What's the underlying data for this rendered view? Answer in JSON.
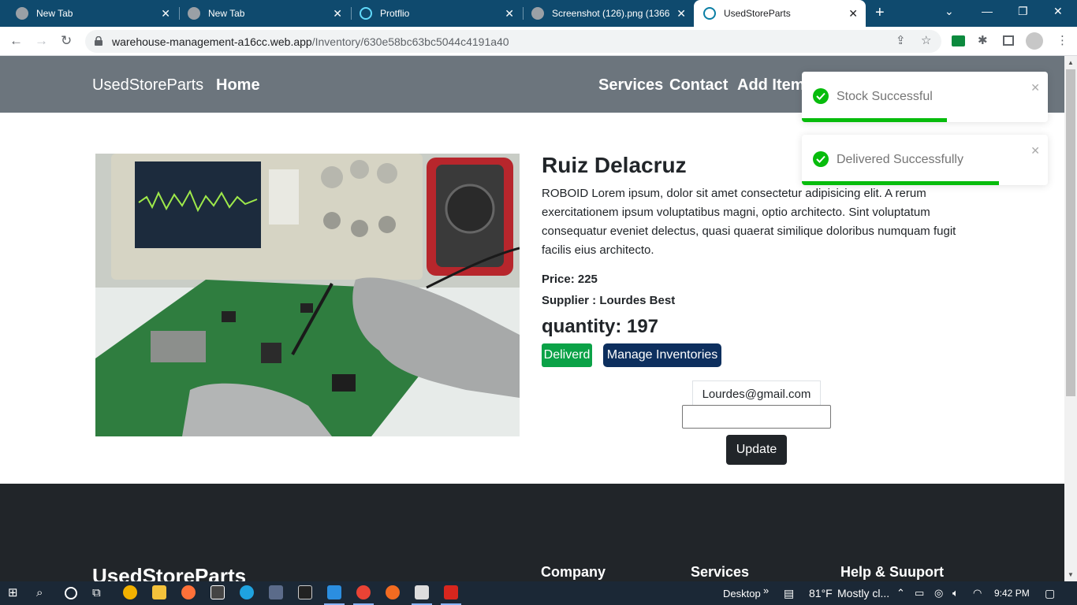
{
  "browser": {
    "tabs": [
      {
        "title": "New Tab",
        "active": false
      },
      {
        "title": "New Tab",
        "active": false
      },
      {
        "title": "Protflio",
        "active": false
      },
      {
        "title": "Screenshot (126).png (1366×",
        "active": false
      },
      {
        "title": "UsedStoreParts",
        "active": true
      }
    ],
    "url_host": "warehouse-management-a16cc.web.app",
    "url_path": "/Inventory/630e58bc63bc5044c4191a40"
  },
  "site": {
    "brand": "UsedStoreParts",
    "nav": {
      "home": "Home",
      "services": "Services",
      "contact": "Contact",
      "add_item": "Add Item"
    }
  },
  "product": {
    "name": "Ruiz Delacruz",
    "description": "ROBOID Lorem ipsum, dolor sit amet consectetur adipisicing elit. A rerum exercitationem ipsum voluptatibus magni, optio architecto. Sint voluptatum consequatur eveniet delectus, quasi quaerat similique doloribus numquam fugit facilis eius architecto.",
    "price_text": "Price: 225",
    "supplier_text": "Supplier : Lourdes Best",
    "quantity_text": "quantity: 197",
    "deliver_label": "Deliverd",
    "manage_label": "Manage Inventories",
    "email": "Lourdes@gmail.com",
    "quantity_input_value": "",
    "update_label": "Update"
  },
  "toasts": [
    {
      "message": "Stock Successful",
      "progress": 0.59
    },
    {
      "message": "Delivered Successfully",
      "progress": 0.8
    }
  ],
  "footer": {
    "brand": "UsedStoreParts",
    "headings": [
      "Company",
      "Services",
      "Help & Suuport"
    ]
  },
  "taskbar": {
    "desktop_label": "Desktop",
    "temperature": "81°F",
    "weather": "Mostly cl...",
    "time": "9:42 PM"
  },
  "colors": {
    "tabstrip": "#0f4a6e",
    "navbar": "#6c757d",
    "deliver_button": "#0ba247",
    "manage_button": "#0d2f5e",
    "footer": "#212529",
    "toast_success": "#07bc0c"
  }
}
